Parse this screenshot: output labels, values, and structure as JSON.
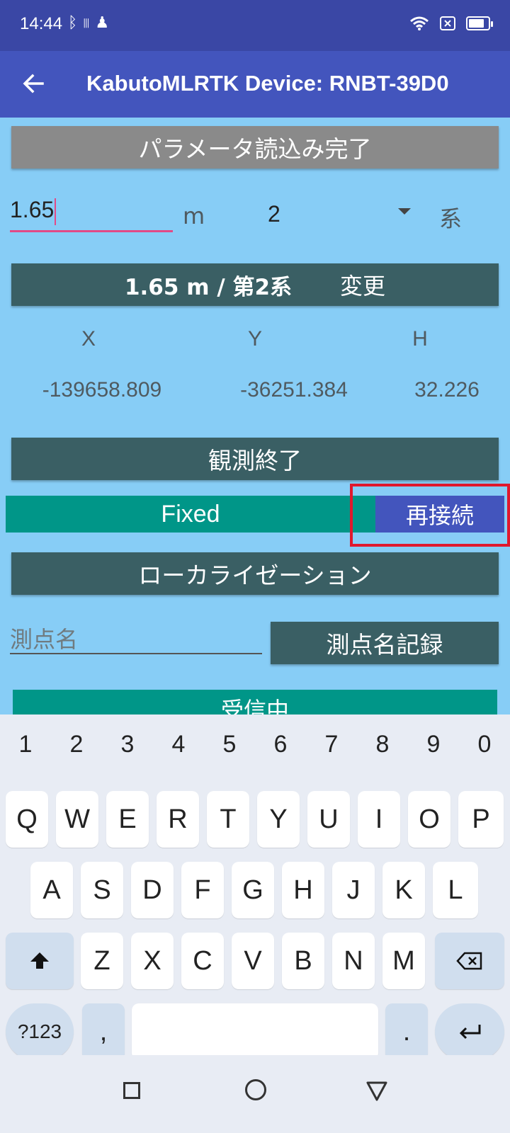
{
  "status_bar": {
    "time": "14:44",
    "left_icons": [
      "bluetooth-icon",
      "vibrate-icon",
      "keyhole-icon"
    ],
    "right_icons": [
      "wifi-icon",
      "no-sim-icon",
      "battery-icon"
    ],
    "battery_level": 0.7
  },
  "app_bar": {
    "back_icon": "arrow-left-icon",
    "title": "KabutoMLRTK Device: RNBT-39D0"
  },
  "form": {
    "param_button": "パラメータ読込み完了",
    "height_value": "1.65",
    "height_unit": "m",
    "zone_selected": "2",
    "zone_suffix": "系",
    "change_button_main": "1.65 m / 第2系",
    "change_button_action": "変更",
    "axes": {
      "x": "X",
      "y": "Y",
      "h": "H"
    },
    "coords": {
      "x": "-139658.809",
      "y": "-36251.384",
      "h": "32.226"
    },
    "end_observation_button": "観測終了",
    "fix_status": "Fixed",
    "reconnect_button": "再接続",
    "localization_button": "ローカライゼーション",
    "station_name_placeholder": "測点名",
    "record_station_button": "測点名記録",
    "receiving_status": "受信中"
  },
  "colors": {
    "status_bar": "#3a47a5",
    "app_bar": "#4355bd",
    "content_bg": "#87cdf6",
    "fixed_bar": "#009688",
    "highlight": "#e0182d"
  },
  "keyboard": {
    "number_row": [
      "1",
      "2",
      "3",
      "4",
      "5",
      "6",
      "7",
      "8",
      "9",
      "0"
    ],
    "row1": [
      "Q",
      "W",
      "E",
      "R",
      "T",
      "Y",
      "U",
      "I",
      "O",
      "P"
    ],
    "row2": [
      "A",
      "S",
      "D",
      "F",
      "G",
      "H",
      "J",
      "K",
      "L"
    ],
    "row3": [
      "Z",
      "X",
      "C",
      "V",
      "B",
      "N",
      "M"
    ],
    "symbols_key": "?123",
    "comma_key": ",",
    "period_key": ".",
    "shift_icon": "shift-icon",
    "backspace_icon": "backspace-icon",
    "enter_icon": "enter-icon"
  },
  "nav_bar": {
    "icons": [
      "recents-square-icon",
      "home-circle-icon",
      "back-triangle-icon"
    ]
  }
}
